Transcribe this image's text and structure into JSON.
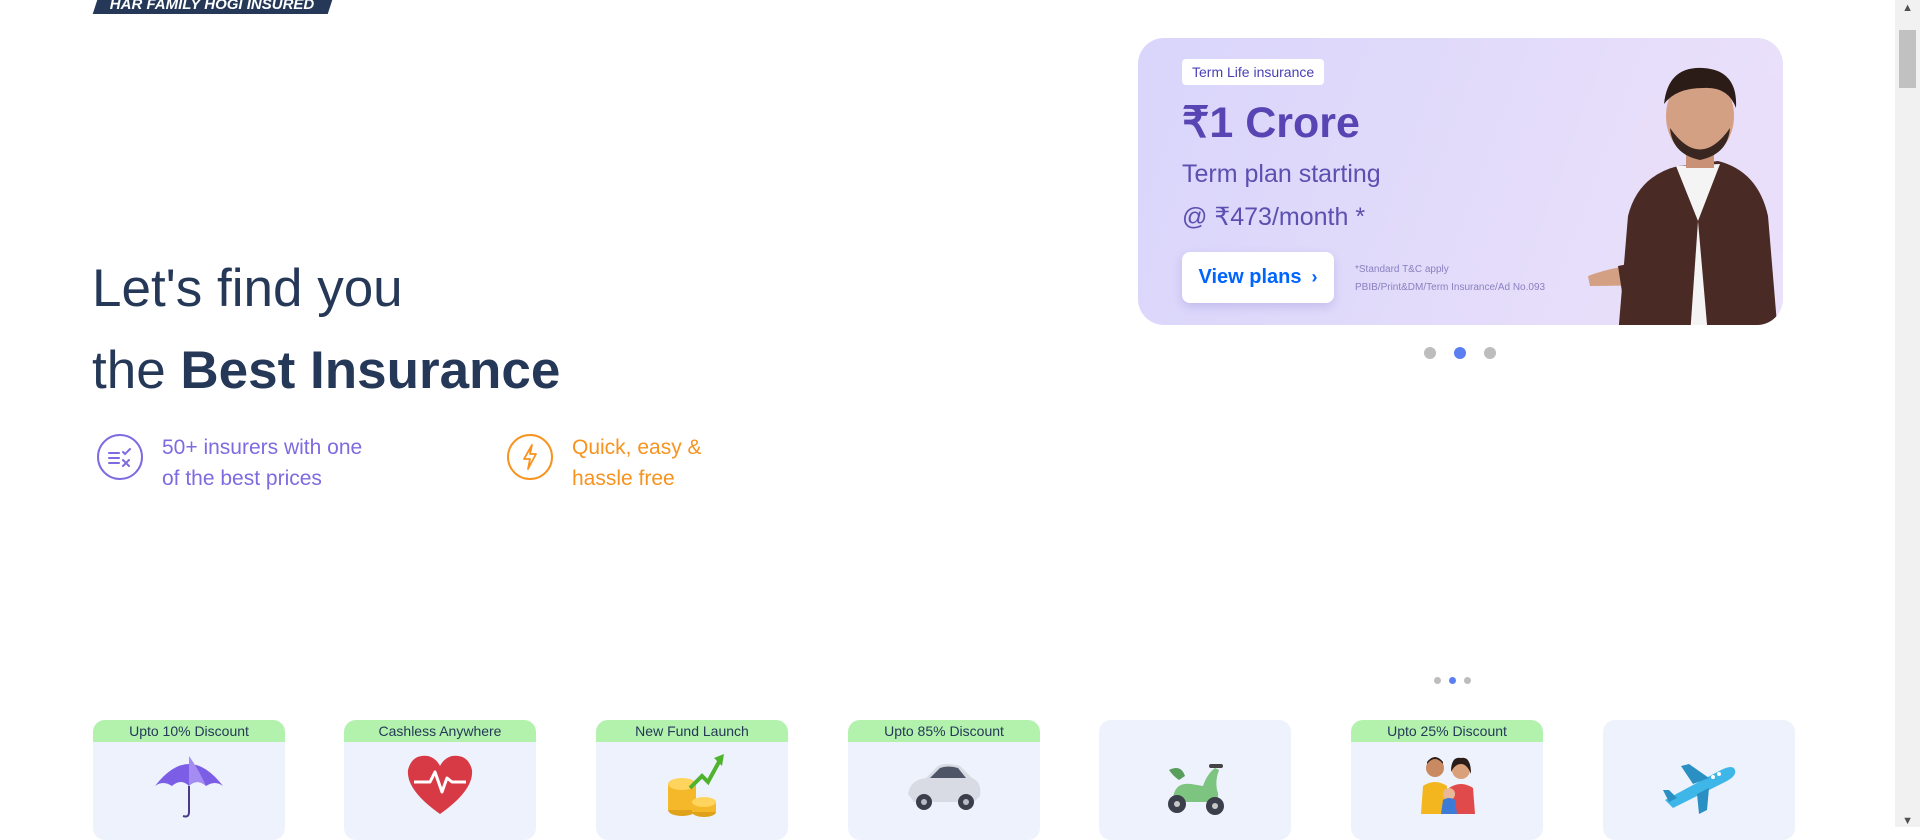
{
  "brand": {
    "tagline": "HAR FAMILY HOGI INSURED"
  },
  "hero": {
    "line1": "Let's find you",
    "line2_prefix": "the ",
    "line2_bold": "Best Insurance"
  },
  "features": [
    {
      "line1": "50+ insurers with one",
      "line2": "of the best prices",
      "color": "#7d6be0",
      "icon": "compare-icon"
    },
    {
      "line1": "Quick, easy &",
      "line2": "hassle free",
      "color": "#f7931e",
      "icon": "lightning-icon"
    }
  ],
  "banner": {
    "tag": "Term Life insurance",
    "amount": "₹1 Crore",
    "sub1": "Term plan starting",
    "sub2": "@ ₹473/month *",
    "button": "View plans",
    "disclaimer1": "*Standard T&C apply",
    "disclaimer2": "PBIB/Print&DM/Term Insurance/Ad No.093"
  },
  "carousel": {
    "count": 3,
    "active": 2
  },
  "mini_carousel": {
    "count": 3,
    "active": 2
  },
  "products": [
    {
      "badge": "Upto 10% Discount",
      "icon": "umbrella-icon"
    },
    {
      "badge": "Cashless Anywhere",
      "icon": "heart-pulse-icon"
    },
    {
      "badge": "New Fund Launch",
      "icon": "coins-growth-icon"
    },
    {
      "badge": "Upto 85% Discount",
      "icon": "car-icon"
    },
    {
      "badge": "",
      "icon": "scooter-icon"
    },
    {
      "badge": "Upto 25% Discount",
      "icon": "family-icon"
    },
    {
      "badge": "",
      "icon": "airplane-icon"
    }
  ],
  "colors": {
    "primary": "#253858",
    "accent": "#0065ff",
    "badge": "#b2f2ad",
    "card_bg": "#eef2fc"
  }
}
